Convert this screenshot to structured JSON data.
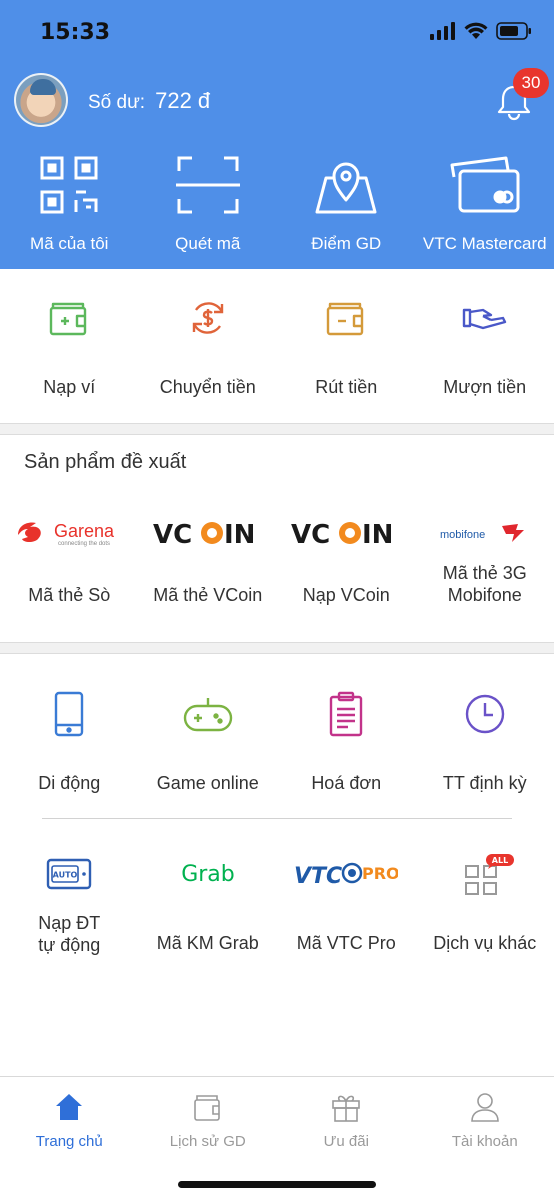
{
  "status_bar": {
    "time": "15:33"
  },
  "header": {
    "balance_label": "Số dư:",
    "balance_value": "722 đ",
    "notification_count": "30",
    "quick_actions": [
      {
        "label": "Mã của tôi",
        "icon": "qr-code-icon"
      },
      {
        "label": "Quét mã",
        "icon": "scan-frame-icon"
      },
      {
        "label": "Điểm GD",
        "icon": "map-pin-icon"
      },
      {
        "label": "VTC Mastercard",
        "icon": "cards-icon"
      }
    ]
  },
  "wallet_actions": [
    {
      "label": "Nạp ví",
      "icon": "wallet-plus-icon",
      "color": "#5cb85c"
    },
    {
      "label": "Chuyển tiền",
      "icon": "dollar-cycle-icon",
      "color": "#e0643a"
    },
    {
      "label": "Rút tiền",
      "icon": "wallet-minus-icon",
      "color": "#d49a3a"
    },
    {
      "label": "Mượn tiền",
      "icon": "hand-money-icon",
      "color": "#4a58c8"
    }
  ],
  "suggested": {
    "title": "Sản phẩm đề xuất",
    "logos": {
      "garena": "Garena",
      "garena_tagline": "connecting the dots",
      "vcoin_left": "VC",
      "vcoin_right": "IN",
      "mobifone": "mobifone"
    },
    "items": [
      {
        "label": "Mã thẻ  Sò",
        "logo": "garena-logo"
      },
      {
        "label": "Mã thẻ VCoin",
        "logo": "vcoin-logo"
      },
      {
        "label": "Nạp VCoin",
        "logo": "vcoin-logo"
      },
      {
        "label_line1": "Mã thẻ 3G",
        "label_line2": "Mobifone",
        "logo": "mobifone-logo"
      }
    ]
  },
  "services_row1": [
    {
      "label": "Di động",
      "icon": "mobile-phone-icon",
      "color": "#3a7bd5"
    },
    {
      "label": "Game online",
      "icon": "gamepad-icon",
      "color": "#7cb342"
    },
    {
      "label": "Hoá đơn",
      "icon": "clipboard-icon",
      "color": "#c2338a"
    },
    {
      "label": "TT định kỳ",
      "icon": "clock-icon",
      "color": "#6a52c8"
    }
  ],
  "services_row2": [
    {
      "label_line1": "Nạp ĐT",
      "label_line2": "tự động",
      "icon": "auto-topup-icon",
      "auto_text": "AUTO",
      "color": "#2f5fb3"
    },
    {
      "label": "Mã KM Grab",
      "icon": "grab-logo",
      "logo_text": "Grab",
      "color": "#00b14f"
    },
    {
      "label": "Mã VTC Pro",
      "icon": "vtc-pro-logo",
      "logo_text_left": "VTC",
      "logo_text_right": "PRO"
    },
    {
      "label": "Dịch vụ khác",
      "icon": "grid-all-icon",
      "badge": "ALL"
    }
  ],
  "tabbar": [
    {
      "label": "Trang chủ",
      "icon": "home-icon",
      "active": true
    },
    {
      "label": "Lịch sử GD",
      "icon": "history-wallet-icon",
      "active": false
    },
    {
      "label": "Ưu đãi",
      "icon": "gift-icon",
      "active": false
    },
    {
      "label": "Tài khoản",
      "icon": "user-icon",
      "active": false
    }
  ]
}
